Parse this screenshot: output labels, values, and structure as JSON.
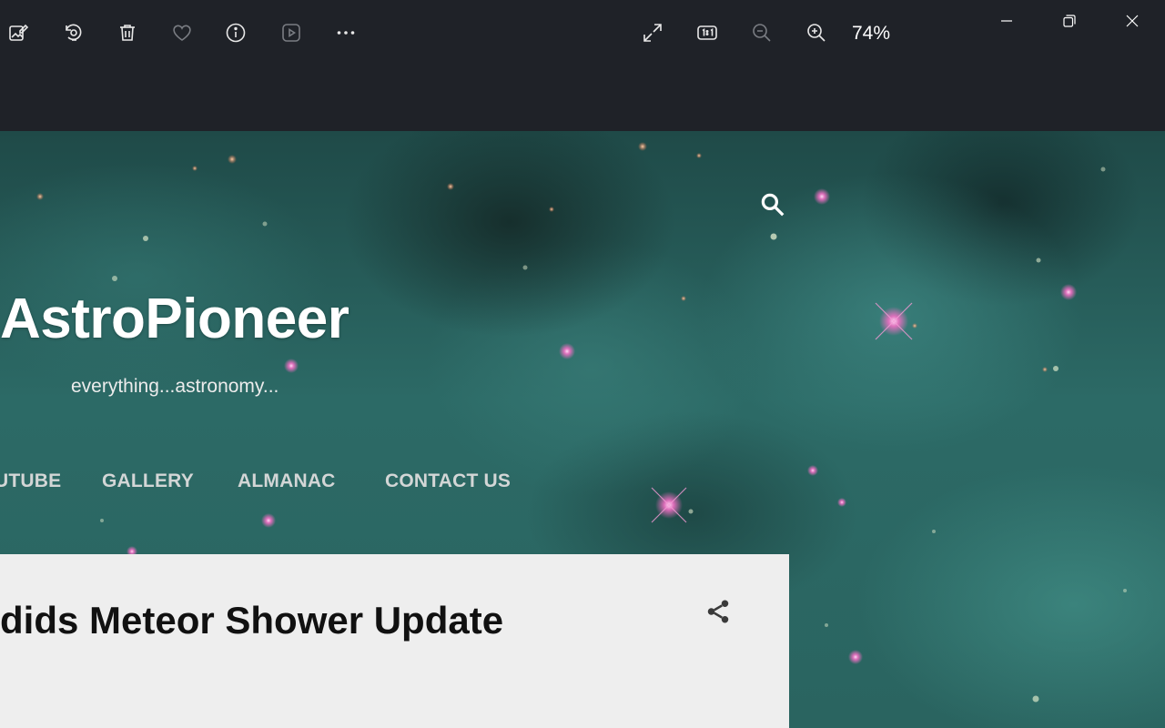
{
  "viewer": {
    "toolbar": [
      {
        "icon": "edit-image-icon"
      },
      {
        "icon": "rotate-icon"
      },
      {
        "icon": "delete-icon"
      },
      {
        "icon": "favorite-heart-icon"
      },
      {
        "icon": "info-icon"
      },
      {
        "icon": "slideshow-icon"
      },
      {
        "icon": "more-options-icon"
      }
    ],
    "view_controls": [
      {
        "icon": "full-screen-icon"
      },
      {
        "icon": "actual-size-icon"
      },
      {
        "icon": "zoom-out-icon"
      },
      {
        "icon": "zoom-in-icon"
      }
    ],
    "zoom_level": "74%",
    "window_controls": [
      {
        "icon": "minimize-icon"
      },
      {
        "icon": "restore-icon"
      },
      {
        "icon": "close-icon"
      }
    ]
  },
  "blog": {
    "title": "AstroPioneer",
    "tagline": "everything...astronomy...",
    "nav": [
      "UTUBE",
      "GALLERY",
      "ALMANAC",
      "CONTACT US"
    ],
    "search_icon": "search-icon",
    "post": {
      "title": "dids Meteor Shower Update",
      "share_icon": "share-icon"
    }
  },
  "colors": {
    "viewer_bar": "#1f2228",
    "nebula_base": "#2c6a66",
    "post_card": "#eeeeee",
    "star_pink": "#f06fc4"
  }
}
